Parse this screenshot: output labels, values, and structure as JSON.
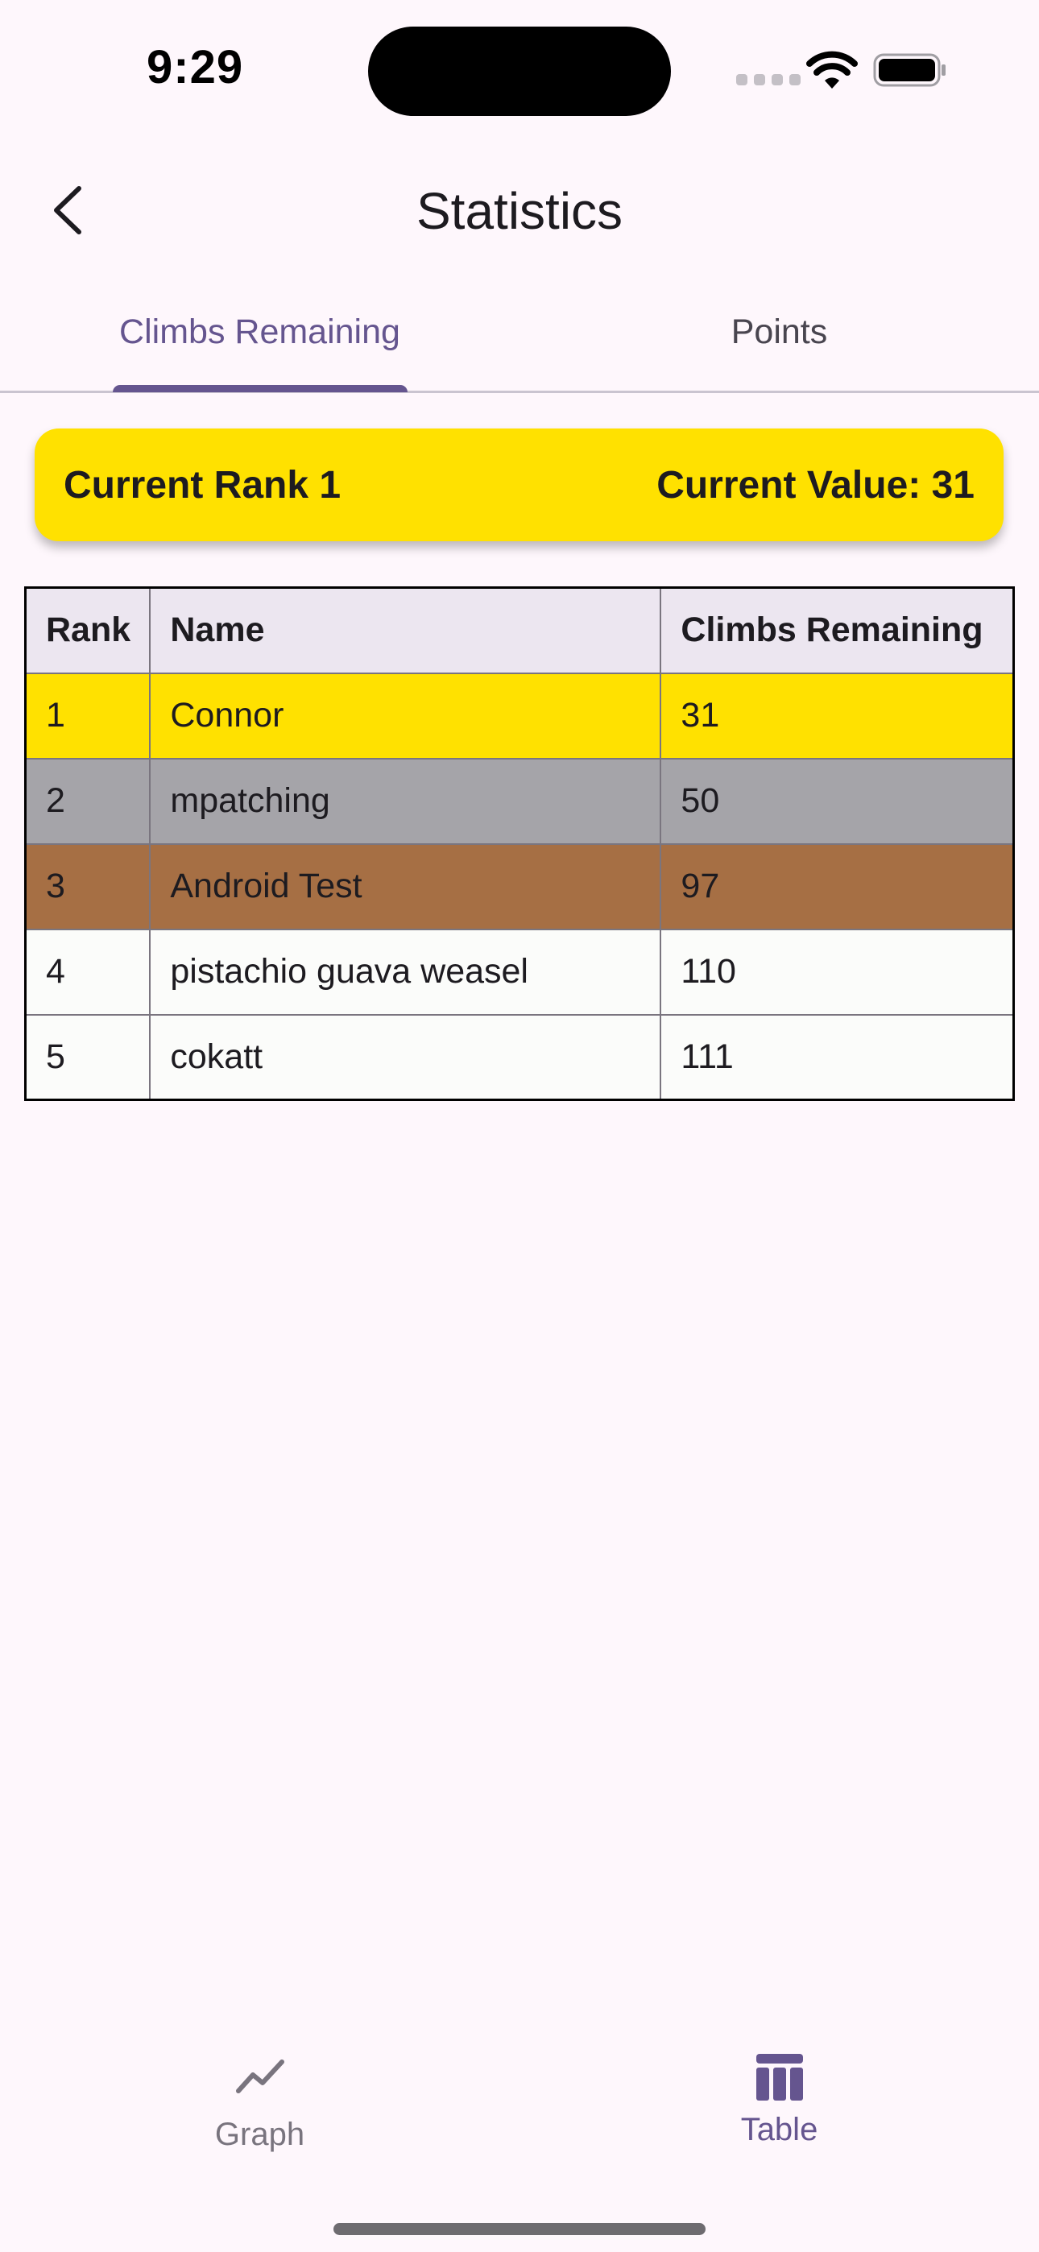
{
  "status": {
    "time": "9:29"
  },
  "app_bar": {
    "title": "Statistics"
  },
  "tabs": [
    {
      "label": "Climbs Remaining",
      "selected": true
    },
    {
      "label": "Points",
      "selected": false
    }
  ],
  "rank_card": {
    "rank_text": "Current Rank 1",
    "value_text": "Current Value: 31"
  },
  "table": {
    "headers": [
      "Rank",
      "Name",
      "Climbs Remaining"
    ],
    "rows": [
      {
        "rank": "1",
        "name": "Connor",
        "value": "31",
        "color": "#ffe100"
      },
      {
        "rank": "2",
        "name": "mpatching",
        "value": "50",
        "color": "#a5a4a9"
      },
      {
        "rank": "3",
        "name": "Android Test",
        "value": "97",
        "color": "#a66f44"
      },
      {
        "rank": "4",
        "name": "pistachio guava weasel",
        "value": "110",
        "color": "#fbfcfa"
      },
      {
        "rank": "5",
        "name": "cokatt",
        "value": "111",
        "color": "#fbfcfa"
      }
    ]
  },
  "bottom_nav": [
    {
      "label": "Graph",
      "icon": "trending-line-icon",
      "selected": false
    },
    {
      "label": "Table",
      "icon": "table-icon",
      "selected": true
    }
  ],
  "colors": {
    "accent": "#65558f",
    "gold": "#ffe100",
    "silver": "#a5a4a9",
    "bronze": "#a66f44",
    "background": "#fef7fc"
  }
}
